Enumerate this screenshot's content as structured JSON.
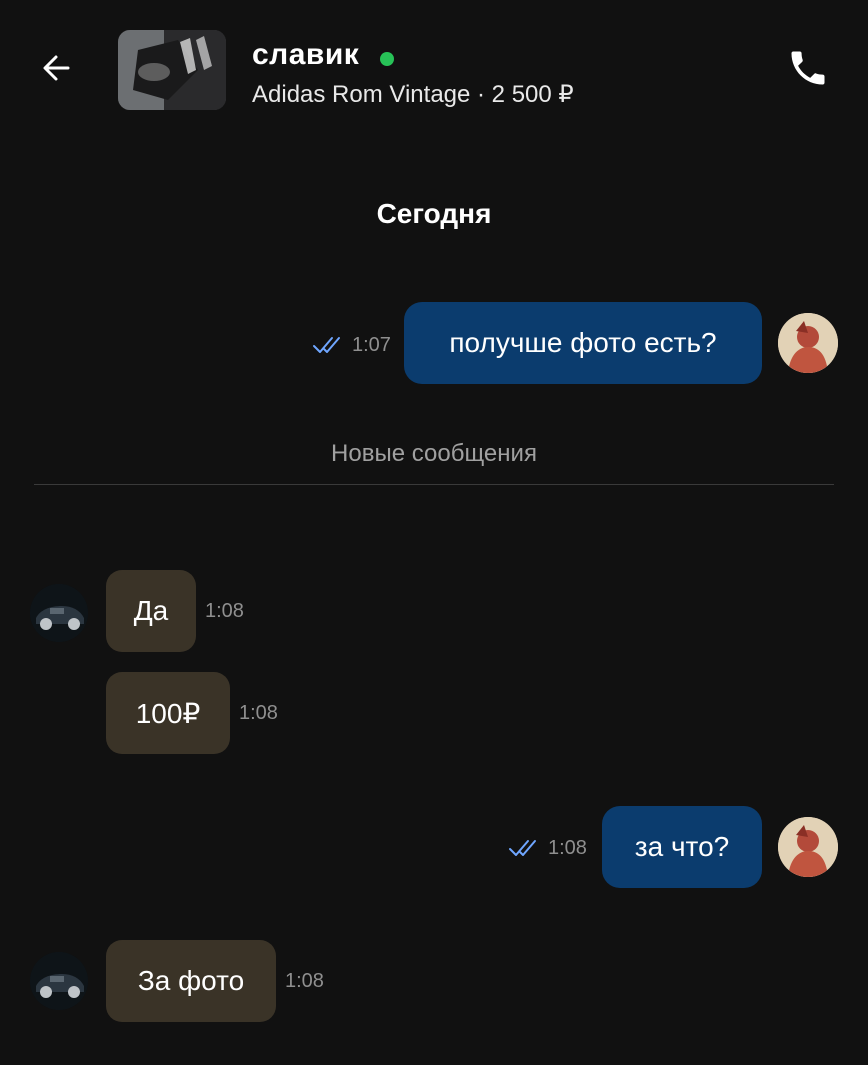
{
  "header": {
    "name": "славик",
    "subtitle": "Adidas Rom Vintage · 2 500 ₽",
    "online": true,
    "online_color": "#27c257",
    "back_icon": "arrow-left-icon",
    "call_icon": "phone-icon"
  },
  "date_separator": "Сегодня",
  "new_messages_label": "Новые сообщения",
  "colors": {
    "outgoing_bubble": "#0b3c6e",
    "incoming_bubble": "#3a3327",
    "read_check": "#6fa6ff"
  },
  "messages": [
    {
      "direction": "out",
      "text": "получше фото есть?",
      "time": "1:07",
      "read": true
    },
    {
      "direction": "in",
      "text": "Да",
      "time": "1:08"
    },
    {
      "direction": "in",
      "text": "100₽",
      "time": "1:08"
    },
    {
      "direction": "out",
      "text": "за что?",
      "time": "1:08",
      "read": true
    },
    {
      "direction": "in",
      "text": "За фото",
      "time": "1:08"
    }
  ]
}
